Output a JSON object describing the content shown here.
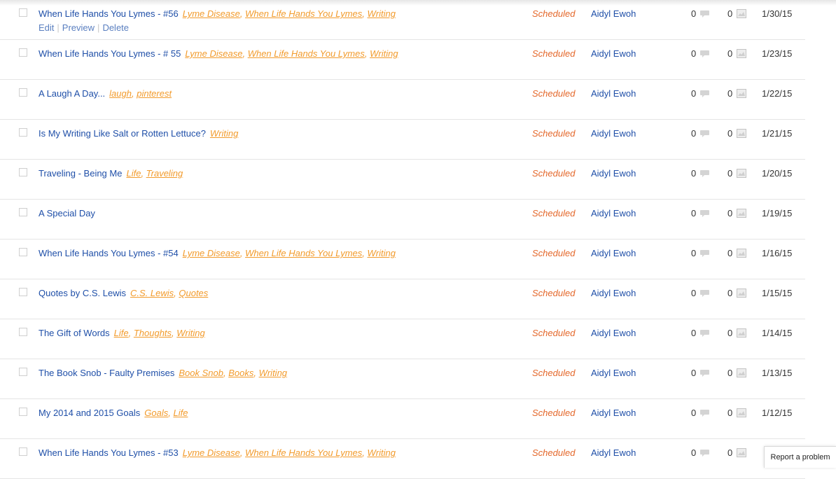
{
  "row_actions": {
    "edit": "Edit",
    "preview": "Preview",
    "delete": "Delete"
  },
  "report_button": "Report a problem",
  "posts": [
    {
      "title": "When Life Hands You Lymes - #56",
      "tags": [
        "Lyme Disease",
        "When Life Hands You Lymes",
        "Writing"
      ],
      "status": "Scheduled",
      "author": "Aidyl Ewoh",
      "comments": "0",
      "images": "0",
      "date": "1/30/15",
      "show_actions": true
    },
    {
      "title": "When Life Hands You Lymes - # 55",
      "tags": [
        "Lyme Disease",
        "When Life Hands You Lymes",
        "Writing"
      ],
      "status": "Scheduled",
      "author": "Aidyl Ewoh",
      "comments": "0",
      "images": "0",
      "date": "1/23/15"
    },
    {
      "title": "A Laugh A Day...",
      "tags": [
        "laugh",
        "pinterest"
      ],
      "status": "Scheduled",
      "author": "Aidyl Ewoh",
      "comments": "0",
      "images": "0",
      "date": "1/22/15"
    },
    {
      "title": "Is My Writing Like Salt or Rotten Lettuce?",
      "tags": [
        "Writing"
      ],
      "status": "Scheduled",
      "author": "Aidyl Ewoh",
      "comments": "0",
      "images": "0",
      "date": "1/21/15"
    },
    {
      "title": "Traveling - Being Me",
      "tags": [
        "Life",
        "Traveling"
      ],
      "status": "Scheduled",
      "author": "Aidyl Ewoh",
      "comments": "0",
      "images": "0",
      "date": "1/20/15"
    },
    {
      "title": "A Special Day",
      "tags": [],
      "status": "Scheduled",
      "author": "Aidyl Ewoh",
      "comments": "0",
      "images": "0",
      "date": "1/19/15"
    },
    {
      "title": "When Life Hands You Lymes - #54",
      "tags": [
        "Lyme Disease",
        "When Life Hands You Lymes",
        "Writing"
      ],
      "status": "Scheduled",
      "author": "Aidyl Ewoh",
      "comments": "0",
      "images": "0",
      "date": "1/16/15"
    },
    {
      "title": "Quotes by C.S. Lewis",
      "tags": [
        "C.S. Lewis",
        "Quotes"
      ],
      "status": "Scheduled",
      "author": "Aidyl Ewoh",
      "comments": "0",
      "images": "0",
      "date": "1/15/15"
    },
    {
      "title": "The Gift of Words",
      "tags": [
        "Life",
        "Thoughts",
        "Writing"
      ],
      "status": "Scheduled",
      "author": "Aidyl Ewoh",
      "comments": "0",
      "images": "0",
      "date": "1/14/15"
    },
    {
      "title": "The Book Snob - Faulty Premises",
      "tags": [
        "Book Snob",
        "Books",
        "Writing"
      ],
      "status": "Scheduled",
      "author": "Aidyl Ewoh",
      "comments": "0",
      "images": "0",
      "date": "1/13/15"
    },
    {
      "title": "My 2014 and 2015 Goals",
      "tags": [
        "Goals",
        "Life"
      ],
      "status": "Scheduled",
      "author": "Aidyl Ewoh",
      "comments": "0",
      "images": "0",
      "date": "1/12/15"
    },
    {
      "title": "When Life Hands You Lymes - #53",
      "tags": [
        "Lyme Disease",
        "When Life Hands You Lymes",
        "Writing"
      ],
      "status": "Scheduled",
      "author": "Aidyl Ewoh",
      "comments": "0",
      "images": "0",
      "date": ""
    }
  ],
  "colors": {
    "title": "#1f4fa8",
    "tag": "#f29b2c",
    "status": "#e4672a"
  },
  "icons": {
    "comments": "comment-bubble-icon",
    "images": "image-icon"
  }
}
